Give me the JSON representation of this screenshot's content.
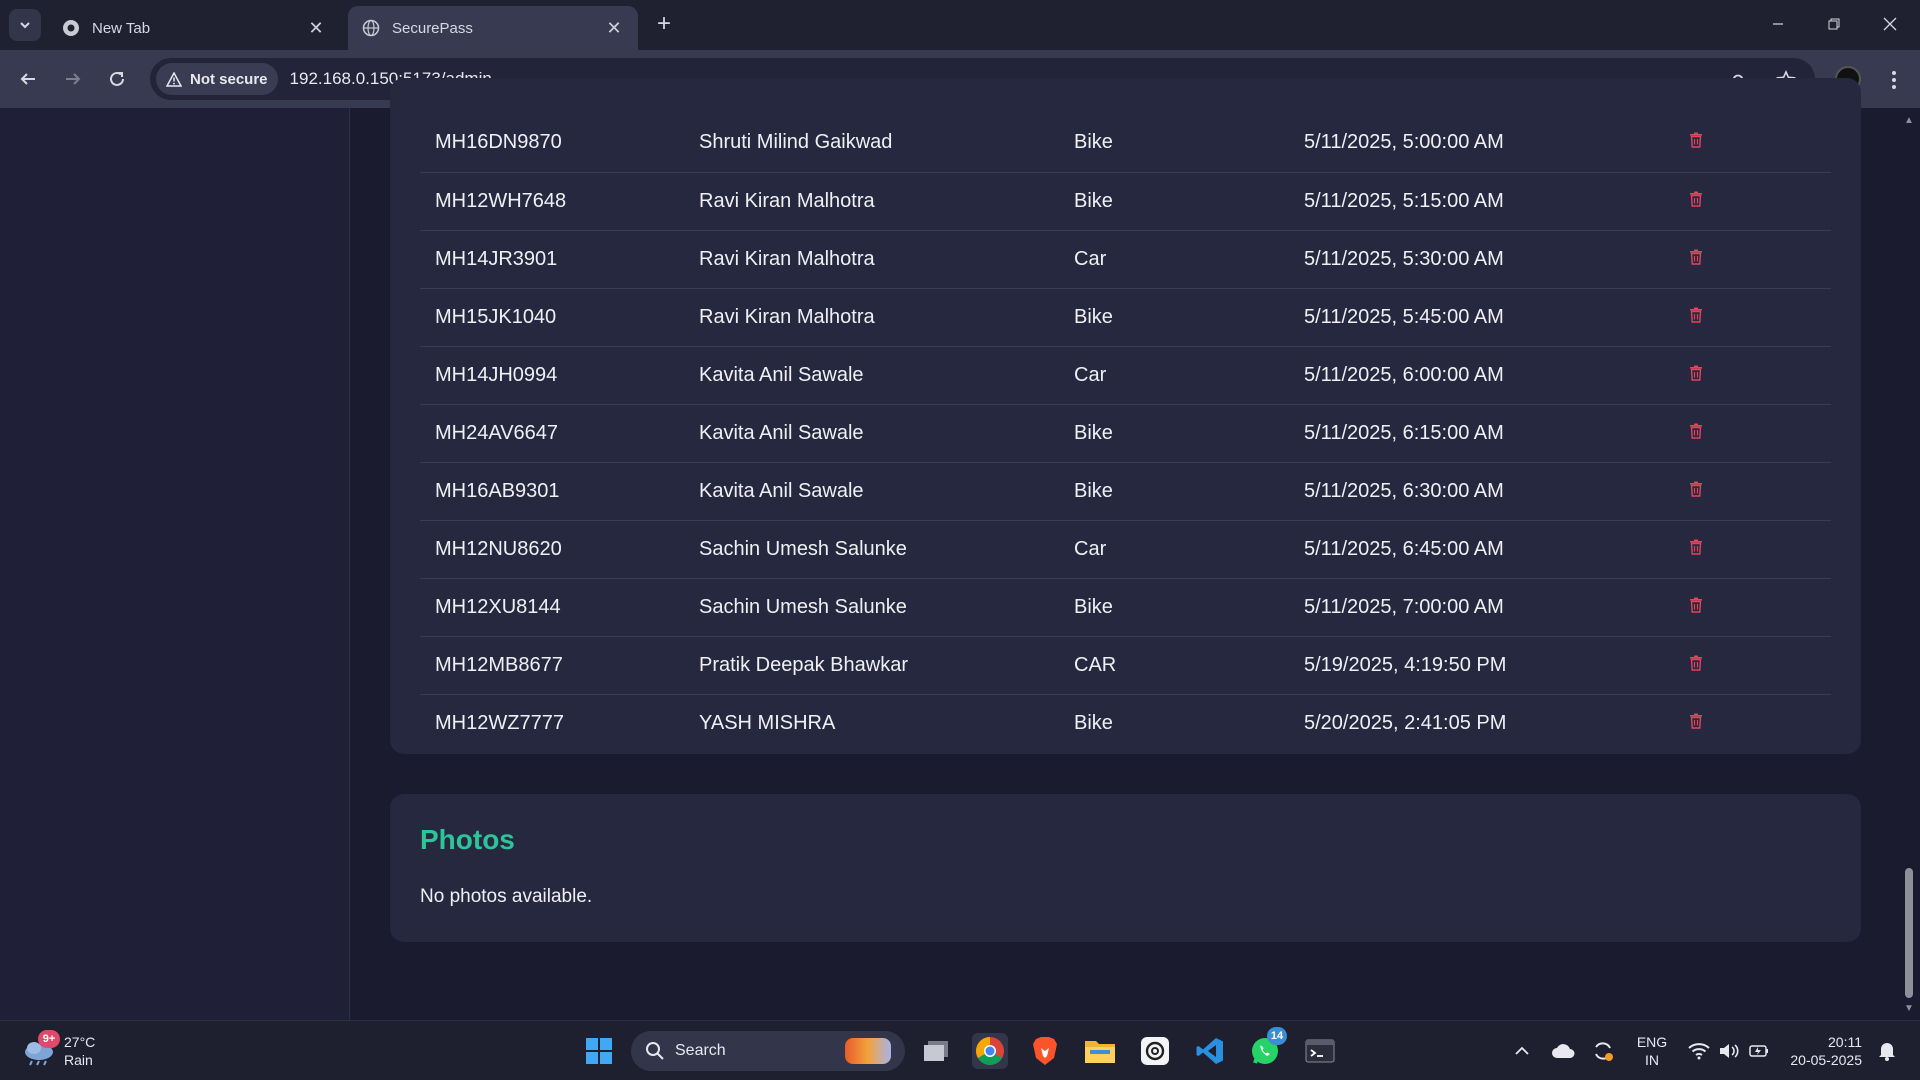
{
  "browser": {
    "tabs": [
      {
        "title": "New Tab",
        "active": false
      },
      {
        "title": "SecurePass",
        "active": true
      }
    ],
    "security_label": "Not secure",
    "url": "192.168.0.150:5173/admin"
  },
  "entries": {
    "rows": [
      {
        "plate": "MH16DN9870",
        "name": "Shruti Milind Gaikwad",
        "type": "Bike",
        "time": "5/11/2025, 5:00:00 AM"
      },
      {
        "plate": "MH12WH7648",
        "name": "Ravi Kiran Malhotra",
        "type": "Bike",
        "time": "5/11/2025, 5:15:00 AM"
      },
      {
        "plate": "MH14JR3901",
        "name": "Ravi Kiran Malhotra",
        "type": "Car",
        "time": "5/11/2025, 5:30:00 AM"
      },
      {
        "plate": "MH15JK1040",
        "name": "Ravi Kiran Malhotra",
        "type": "Bike",
        "time": "5/11/2025, 5:45:00 AM"
      },
      {
        "plate": "MH14JH0994",
        "name": "Kavita Anil Sawale",
        "type": "Car",
        "time": "5/11/2025, 6:00:00 AM"
      },
      {
        "plate": "MH24AV6647",
        "name": "Kavita Anil Sawale",
        "type": "Bike",
        "time": "5/11/2025, 6:15:00 AM"
      },
      {
        "plate": "MH16AB9301",
        "name": "Kavita Anil Sawale",
        "type": "Bike",
        "time": "5/11/2025, 6:30:00 AM"
      },
      {
        "plate": "MH12NU8620",
        "name": "Sachin Umesh Salunke",
        "type": "Car",
        "time": "5/11/2025, 6:45:00 AM"
      },
      {
        "plate": "MH12XU8144",
        "name": "Sachin Umesh Salunke",
        "type": "Bike",
        "time": "5/11/2025, 7:00:00 AM"
      },
      {
        "plate": "MH12MB8677",
        "name": "Pratik Deepak Bhawkar",
        "type": "CAR",
        "time": "5/19/2025, 4:19:50 PM"
      },
      {
        "plate": "MH12WZ7777",
        "name": "YASH MISHRA",
        "type": "Bike",
        "time": "5/20/2025, 2:41:05 PM"
      }
    ],
    "delete_icon": "trash-icon",
    "delete_color": "#e0455a"
  },
  "photos": {
    "title": "Photos",
    "empty_message": "No photos available.",
    "title_color": "#2ec49a"
  },
  "taskbar": {
    "weather": {
      "badge": "9+",
      "temp": "27°C",
      "condition": "Rain"
    },
    "search_label": "Search",
    "whatsapp_badge": "14",
    "lang_top": "ENG",
    "lang_bottom": "IN",
    "time": "20:11",
    "date": "20-05-2025"
  }
}
